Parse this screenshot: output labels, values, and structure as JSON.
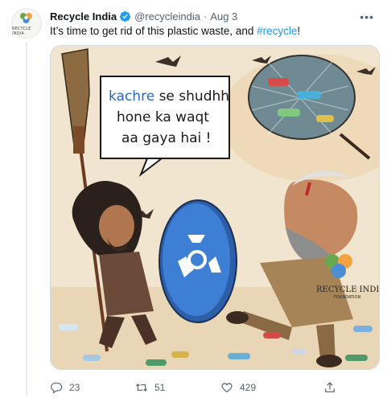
{
  "account": {
    "name": "Recycle India",
    "handle": "@recycleindia",
    "date": "Aug 3",
    "avatar_text": "RECYCLE INDIA"
  },
  "tweet": {
    "text_prefix": "It’s time to get rid of this plastic waste, and ",
    "hashtag": "#recycle",
    "text_suffix": "!"
  },
  "cartoon": {
    "bubble_highlight": "kachre",
    "bubble_line1_rest": " se shudhh",
    "bubble_line2": "hone ka waqt",
    "bubble_line3": "aa gaya hai !",
    "logo_main": "RECYCLE INDIA",
    "logo_sub": "FOUNDATION"
  },
  "actions": {
    "replies": "23",
    "retweets": "51",
    "likes": "429"
  },
  "colors": {
    "verified": "#1d9bf0",
    "hashtag": "#1d9bf0",
    "muted": "#536471",
    "shield": "#3e7fd6"
  },
  "icons": [
    "verified-badge-icon",
    "more-icon",
    "reply-icon",
    "retweet-icon",
    "like-icon",
    "share-icon"
  ]
}
